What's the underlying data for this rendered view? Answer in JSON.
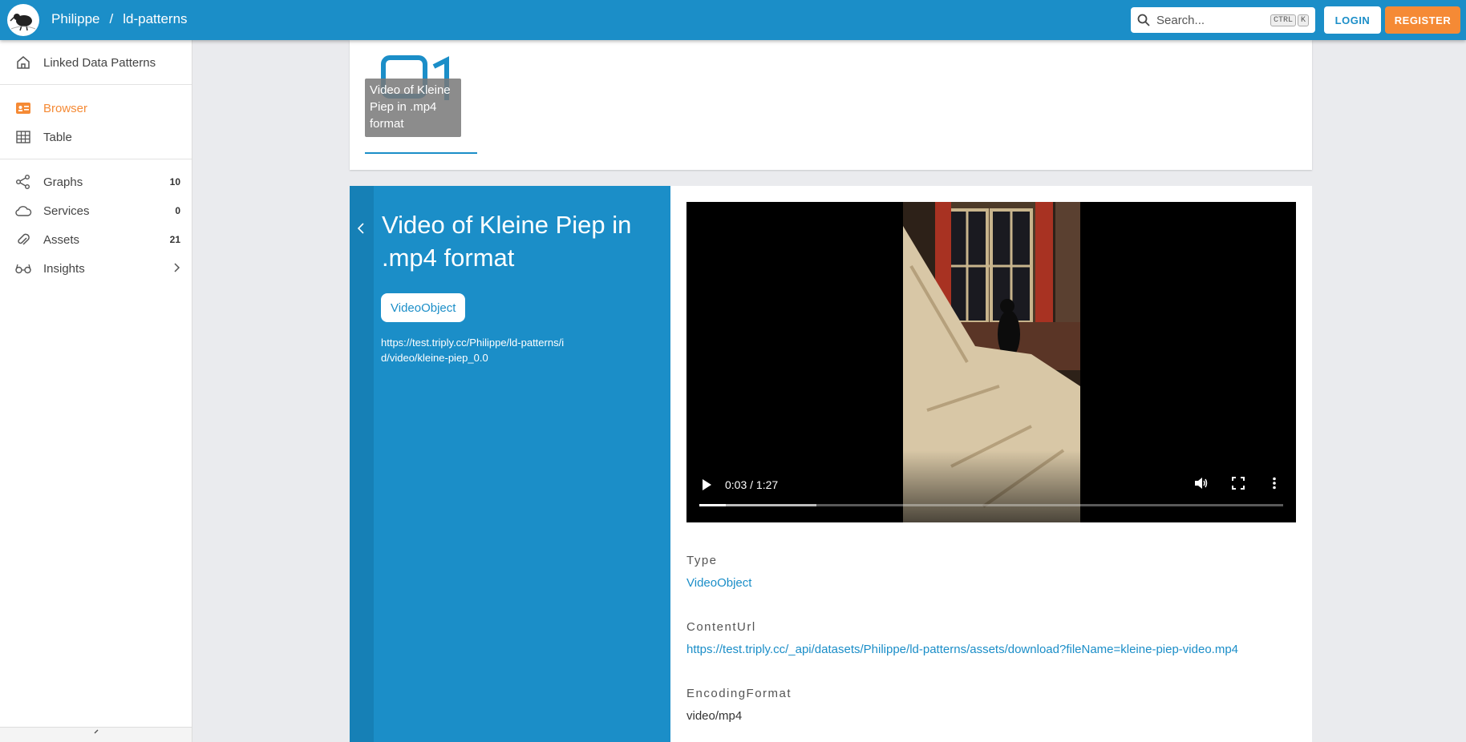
{
  "header": {
    "owner": "Philippe",
    "separator": "/",
    "dataset": "ld-patterns",
    "search_placeholder": "Search...",
    "shortcut_ctrl": "CTRL",
    "shortcut_key": "K",
    "login_label": "LOGIN",
    "register_label": "REGISTER",
    "brand_color": "#1b8ec8",
    "accent_color": "#f58a35"
  },
  "sidebar": {
    "items": [
      {
        "label": "Linked Data Patterns",
        "icon": "home-icon"
      },
      {
        "label": "Browser",
        "icon": "browser-icon",
        "active": true
      },
      {
        "label": "Table",
        "icon": "table-icon"
      },
      {
        "label": "Graphs",
        "icon": "graphs-icon",
        "count": "10"
      },
      {
        "label": "Services",
        "icon": "cloud-icon",
        "count": "0"
      },
      {
        "label": "Assets",
        "icon": "paperclip-icon",
        "count": "21"
      },
      {
        "label": "Insights",
        "icon": "glasses-icon"
      }
    ]
  },
  "thumbnail": {
    "caption": "Video of Kleine Piep in .mp4 format"
  },
  "detail": {
    "title": "Video of Kleine Piep in .mp4 format",
    "type_chip": "VideoObject",
    "iri": "https://test.triply.cc/Philippe/ld-patterns/id/video/kleine-piep_0.0"
  },
  "video": {
    "time": "0:03 / 1:27",
    "played_fraction": 0.045,
    "buffered_fraction": 0.2
  },
  "properties": [
    {
      "key": "Type",
      "value": "VideoObject",
      "link": true
    },
    {
      "key": "ContentUrl",
      "value": "https://test.triply.cc/_api/datasets/Philippe/ld-patterns/assets/download?fileName=kleine-piep-video.mp4",
      "link": true
    },
    {
      "key": "EncodingFormat",
      "value": "video/mp4",
      "link": false
    }
  ]
}
